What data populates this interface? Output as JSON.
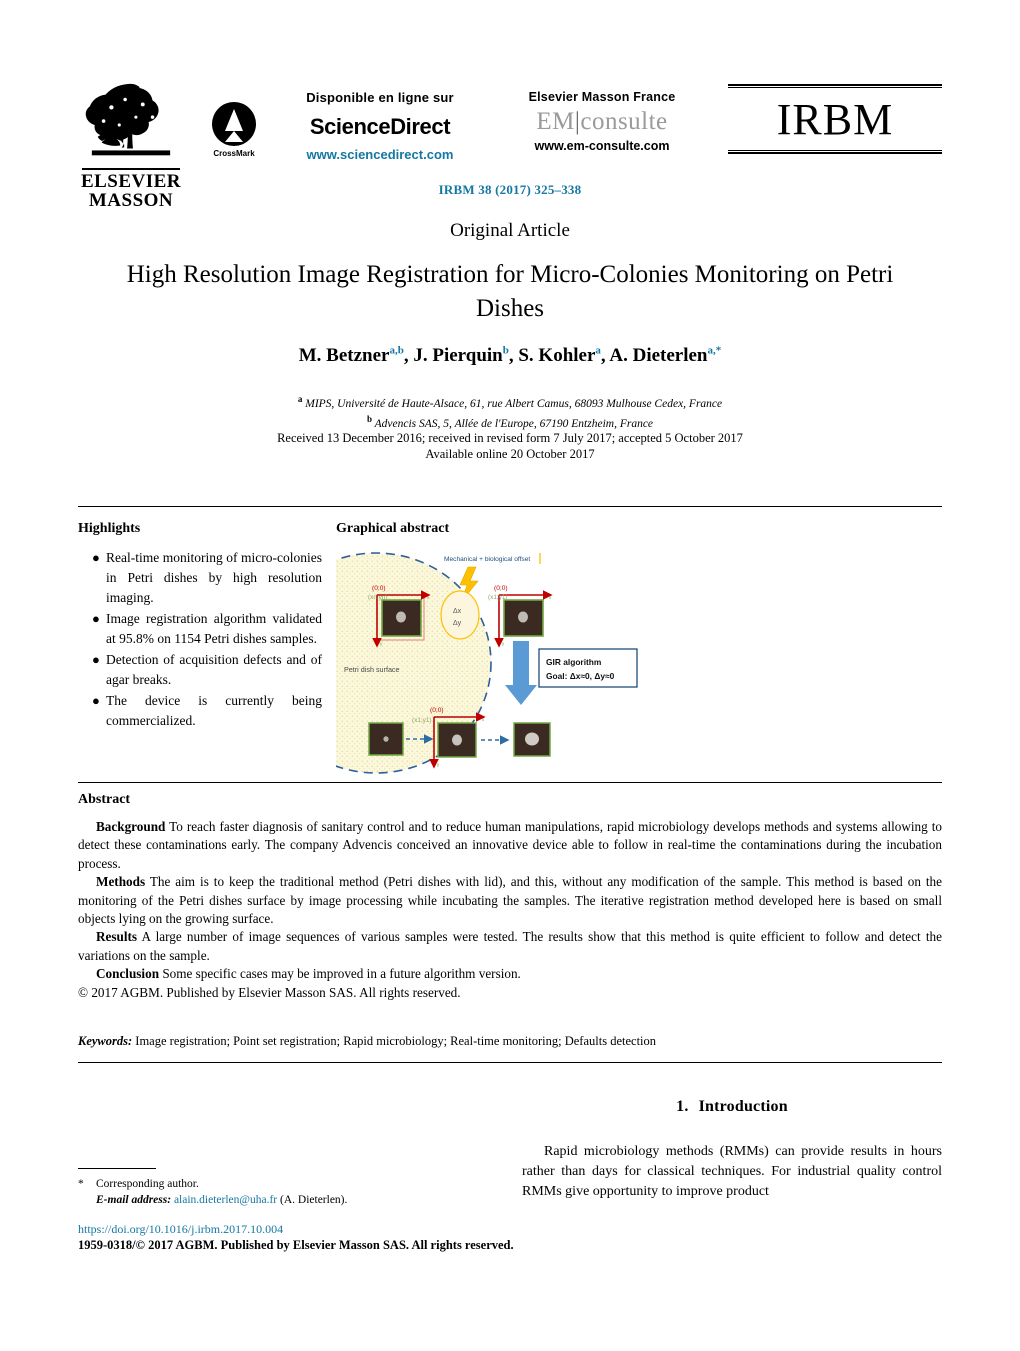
{
  "masthead": {
    "publisher_logo_line1": "ELSEVIER",
    "publisher_logo_line2": "MASSON",
    "crossmark_label": "CrossMark",
    "sciencedirect": {
      "available_online": "Disponible en ligne sur",
      "brand": "ScienceDirect",
      "url": "www.sciencedirect.com"
    },
    "emconsulte": {
      "line1": "Elsevier Masson France",
      "brand_left": "EM",
      "brand_bar": "|",
      "brand_right": "consulte",
      "url": "www.em-consulte.com"
    },
    "journal_logo": "IRBM",
    "journal_reference": "IRBM 38 (2017) 325–338"
  },
  "article": {
    "type": "Original Article",
    "title": "High Resolution Image Registration for Micro-Colonies Monitoring on Petri Dishes",
    "authors": [
      {
        "name": "M. Betzner",
        "sup": "a,b"
      },
      {
        "name": "J. Pierquin",
        "sup": "b"
      },
      {
        "name": "S. Kohler",
        "sup": "a"
      },
      {
        "name": "A. Dieterlen",
        "sup": "a,*"
      }
    ],
    "affiliations": [
      {
        "marker": "a",
        "text": "MIPS, Université de Haute-Alsace, 61, rue Albert Camus, 68093 Mulhouse Cedex, France"
      },
      {
        "marker": "b",
        "text": "Advencis SAS, 5, Allée de l'Europe, 67190 Entzheim, France"
      }
    ],
    "history_line1": "Received 13 December 2016; received in revised form 7 July 2017; accepted 5 October 2017",
    "history_line2": "Available online 20 October 2017"
  },
  "highlights": {
    "heading": "Highlights",
    "bullet_glyph": "●",
    "items": [
      "Real-time monitoring of micro-colonies in Petri dishes by high resolution imaging.",
      "Image registration algorithm validated at 95.8% on 1154 Petri dishes samples.",
      "Detection of acquisition defects and of agar breaks.",
      "The device is currently being commercialized."
    ]
  },
  "graphical_abstract": {
    "heading": "Graphical abstract",
    "labels": {
      "offset_banner": "Mechanical + biological offset",
      "petri_surface": "Petri dish surface",
      "delta_x": "Δx",
      "delta_y": "Δy",
      "origin_top_left": "(0;0)",
      "coord_xnyn": "(xn;yn)",
      "coord_x1y1": "(x1;y1)",
      "origin_bottom": "(0;0)",
      "algo_title": "GIR algorithm",
      "algo_goal": "Goal: Δx≈0, Δy≈0"
    },
    "colors": {
      "agar": "#f8f3cf",
      "dish_border": "#2f5f9e",
      "red_axis": "#c00000",
      "green_frame": "#71a844",
      "arrow_blue": "#5b9bd5",
      "bolt_yellow": "#ffc000",
      "box_border": "#1f4e79",
      "colony_bg": "#3a2a22"
    }
  },
  "abstract": {
    "heading": "Abstract",
    "paragraphs": [
      {
        "label": "Background",
        "text": "To reach faster diagnosis of sanitary control and to reduce human manipulations, rapid microbiology develops methods and systems allowing to detect these contaminations early. The company Advencis conceived an innovative device able to follow in real-time the contaminations during the incubation process."
      },
      {
        "label": "Methods",
        "text": "The aim is to keep the traditional method (Petri dishes with lid), and this, without any modification of the sample. This method is based on the monitoring of the Petri dishes surface by image processing while incubating the samples. The iterative registration method developed here is based on small objects lying on the growing surface."
      },
      {
        "label": "Results",
        "text": "A large number of image sequences of various samples were tested. The results show that this method is quite efficient to follow and detect the variations on the sample."
      },
      {
        "label": "Conclusion",
        "text": "Some specific cases may be improved in a future algorithm version."
      }
    ],
    "copyright": "© 2017 AGBM. Published by Elsevier Masson SAS. All rights reserved."
  },
  "keywords": {
    "label": "Keywords:",
    "text": "Image registration; Point set registration; Rapid microbiology; Real-time monitoring; Defaults detection"
  },
  "body": {
    "section_number": "1.",
    "section_title": "Introduction",
    "first_paragraph": "Rapid microbiology methods (RMMs) can provide results in hours rather than days for classical techniques. For industrial quality control RMMs give opportunity to improve product"
  },
  "footer": {
    "star": "*",
    "corresponding_author": "Corresponding author.",
    "email_label": "E-mail address:",
    "email": "alain.dieterlen@uha.fr",
    "email_attribution": "(A. Dieterlen).",
    "doi": "https://doi.org/10.1016/j.irbm.2017.10.004",
    "issn_line": "1959-0318/© 2017 AGBM. Published by Elsevier Masson SAS. All rights reserved."
  },
  "colors": {
    "link": "#1577a3",
    "text": "#000000",
    "background": "#ffffff"
  }
}
